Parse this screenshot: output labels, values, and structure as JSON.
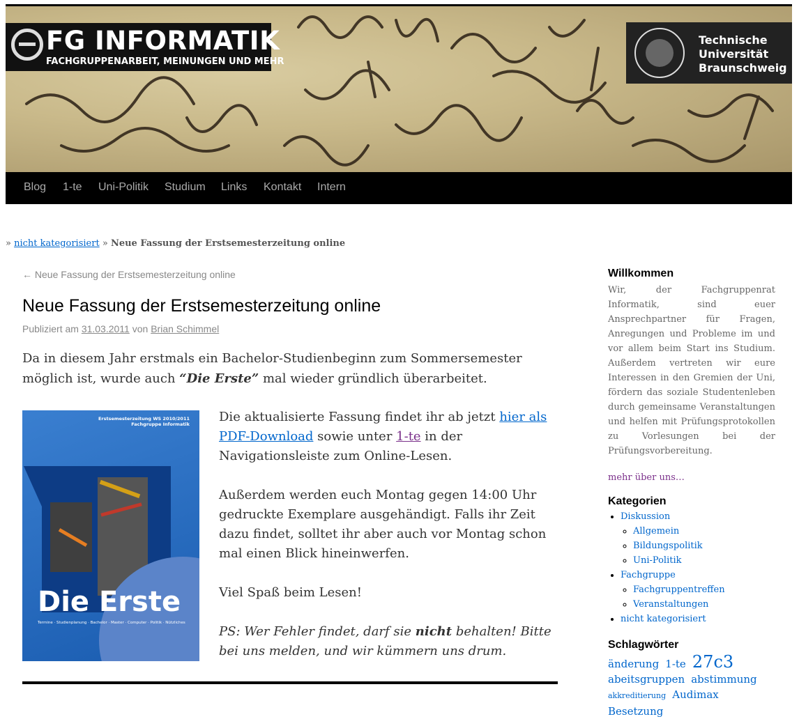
{
  "header": {
    "logo_title": "FG INFORMATIK",
    "logo_subtitle": "FACHGRUPPENARBEIT, MEINUNGEN UND MEHR",
    "university_line1": "Technische",
    "university_line2": "Universität",
    "university_line3": "Braunschweig"
  },
  "nav": {
    "items": [
      "Blog",
      "1-te",
      "Uni-Politik",
      "Studium",
      "Links",
      "Kontakt",
      "Intern"
    ]
  },
  "breadcrumb": {
    "sep": "»",
    "category": "nicht kategorisiert",
    "current": "Neue Fassung der Erstsemesterzeitung online"
  },
  "post": {
    "prev_arrow": "←",
    "prev_link": "Neue Fassung der Erstsemesterzeitung online",
    "title": "Neue Fassung der Erstsemesterzeitung online",
    "meta_prefix": "Publiziert am",
    "date": "31.03.2011",
    "meta_by": "von",
    "author": "Brian Schimmel",
    "intro_a": "Da in diesem Jahr erstmals ein Bachelor-Studienbeginn zum Sommersemester möglich ist, wurde auch ",
    "intro_em": "“Die Erste”",
    "intro_b": " mal wieder gründlich überarbeitet.",
    "cover_header_1": "Erstsemesterzeitung WS 2010/2011",
    "cover_header_2": "Fachgruppe Informatik",
    "cover_title": "Die Erste",
    "cover_subtitle": "Termine · Studienplanung · Bachelor · Master · Computer · Politik · Nützliches",
    "p1_a": "Die aktualisierte Fassung findet ihr ab jetzt ",
    "p1_link1": "hier als PDF-Download",
    "p1_b": " sowie unter ",
    "p1_link2": "1-te",
    "p1_c": " in der Navigationsleiste zum Online-Lesen.",
    "p2": "Außerdem werden euch Montag gegen 14:00 Uhr gedruckte Exemplare ausgehändigt. Falls ihr Zeit dazu findet, solltet ihr aber auch vor Montag schon mal einen Blick hineinwerfen.",
    "p3": "Viel Spaß beim Lesen!",
    "ps_a": "PS: Wer Fehler findet, darf sie ",
    "ps_strong": "nicht",
    "ps_b": " behalten! Bitte bei uns melden, und wir kümmern uns drum."
  },
  "sidebar": {
    "welcome_title": "Willkommen",
    "welcome_text": "Wir, der Fachgruppenrat Informatik, sind euer Ansprechpartner für Fragen, Anregungen und Probleme im und vor allem beim Start ins Studium. Außerdem vertreten wir eure Interessen in den Gremien der Uni, fördern das soziale Studentenleben durch gemeinsame Veranstaltungen und helfen mit Prüfungsprotokollen zu Vorlesungen bei der Prüfungsvorbereitung.",
    "more_link": "mehr über uns…",
    "categories_title": "Kategorien",
    "categories": [
      {
        "label": "Diskussion",
        "children": [
          "Allgemein",
          "Bildungspolitik",
          "Uni-Politik"
        ]
      },
      {
        "label": "Fachgruppe",
        "children": [
          "Fachgruppentreffen",
          "Veranstaltungen"
        ]
      },
      {
        "label": "nicht kategorisiert",
        "children": []
      }
    ],
    "tags_title": "Schlagwörter",
    "tags": [
      "änderung",
      "1-te",
      "27c3",
      "abeitsgruppen",
      "abstimmung",
      "akkreditierung",
      "Audimax",
      "Besetzung"
    ]
  },
  "colors": {
    "link": "#0066cc",
    "visited": "#7a2f8a",
    "nav_bg": "#000000",
    "nav_text": "#aaaaaa"
  }
}
